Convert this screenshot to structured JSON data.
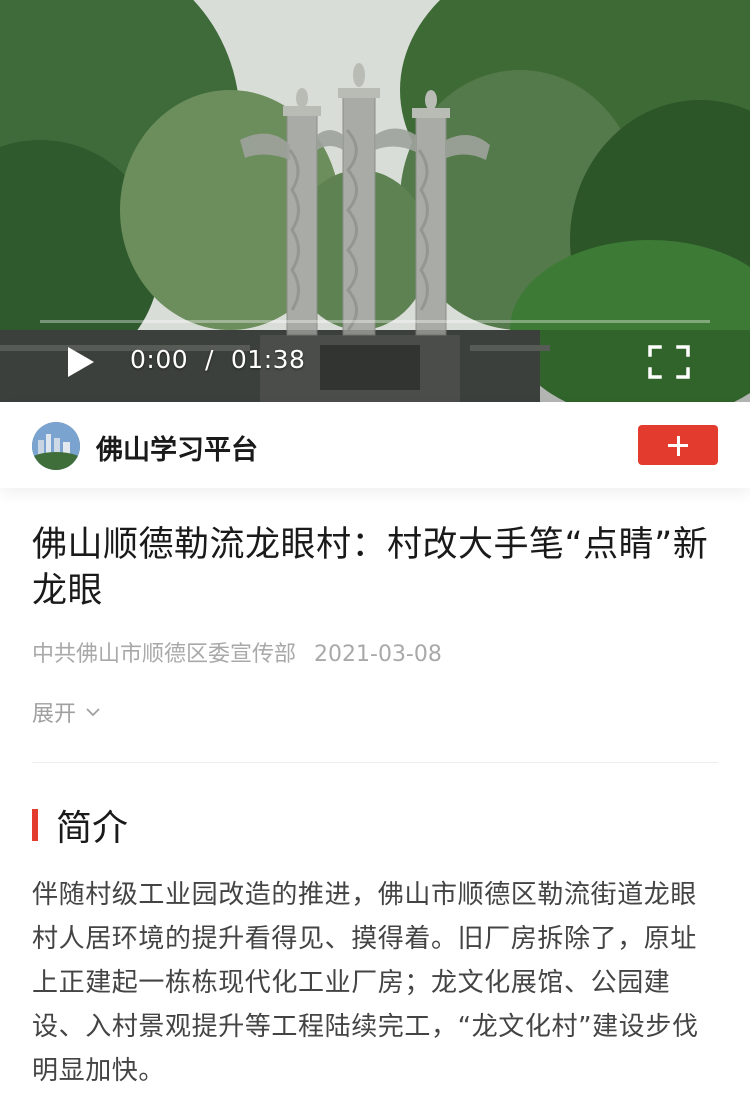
{
  "video": {
    "current_time": "0:00",
    "separator": "/",
    "duration": "01:38",
    "play_icon": "play-icon",
    "fullscreen_icon": "fullscreen-icon"
  },
  "account": {
    "name": "佛山学习平台",
    "follow_icon": "plus-icon",
    "accent_color": "#e33c2e"
  },
  "article": {
    "title": "佛山顺德勒流龙眼村：村改大手笔“点睛”新龙眼",
    "source": "中共佛山市顺德区委宣传部",
    "date": "2021-03-08",
    "expand_label": "展开"
  },
  "intro": {
    "heading": "简介",
    "text": "伴随村级工业园改造的推进，佛山市顺德区勒流街道龙眼村人居环境的提升看得见、摸得着。旧厂房拆除了，原址上正建起一栋栋现代化工业厂房；龙文化展馆、公园建设、入村景观提升等工程陆续完工，“龙文化村”建设步伐明显加快。"
  }
}
